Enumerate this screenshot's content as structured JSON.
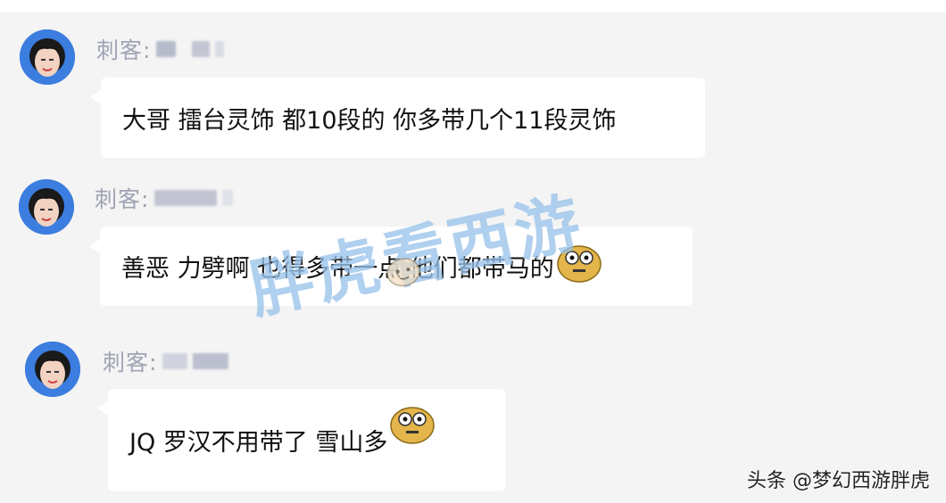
{
  "messages": [
    {
      "sender": "刺客:",
      "text": "大哥 擂台灵饰 都10段的 你多带几个11段灵饰",
      "emoji": ""
    },
    {
      "sender": "刺客:",
      "text": "善恶 力劈啊 也得多带一点 他们都带马的",
      "emoji": "shocked-face-icon"
    },
    {
      "sender": "刺客:",
      "text": "JQ 罗汉不用带了 雪山多",
      "emoji": "shocked-face-icon"
    }
  ],
  "watermark": "胖虎看西游",
  "footer": "头条 @梦幻西游胖虎",
  "colors": {
    "bubble": "#ffffff",
    "background": "#f4f4f4",
    "sender": "#9fa3b4",
    "watermark": "#5096dc"
  }
}
